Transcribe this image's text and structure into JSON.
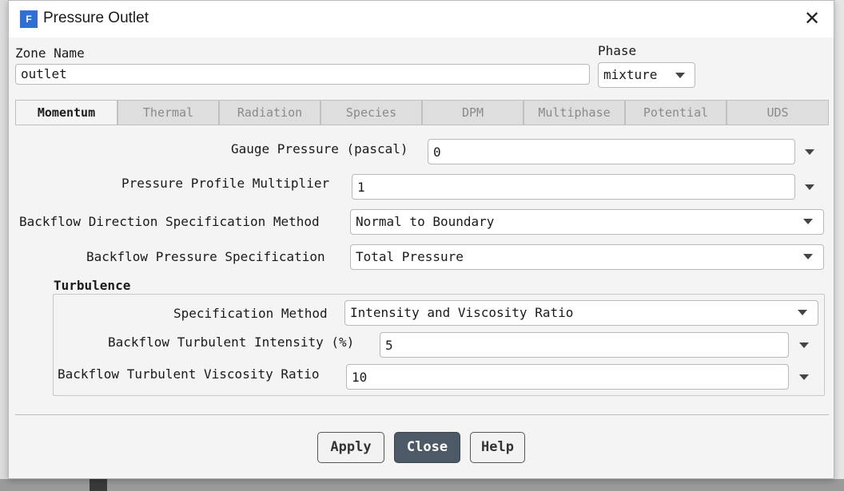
{
  "window": {
    "title": "Pressure Outlet",
    "icon": "fluent-app-icon",
    "close_glyph": "✕"
  },
  "zone": {
    "label": "Zone Name",
    "value": "outlet"
  },
  "phase": {
    "label": "Phase",
    "value": "mixture"
  },
  "tabs": [
    {
      "label": "Momentum",
      "active": true
    },
    {
      "label": "Thermal"
    },
    {
      "label": "Radiation"
    },
    {
      "label": "Species"
    },
    {
      "label": "DPM"
    },
    {
      "label": "Multiphase"
    },
    {
      "label": "Potential"
    },
    {
      "label": "UDS"
    }
  ],
  "momentum": {
    "gauge_pressure": {
      "label": "Gauge Pressure (pascal)",
      "value": "0"
    },
    "pressure_profile_multiplier": {
      "label": "Pressure Profile Multiplier",
      "value": "1"
    },
    "backflow_direction": {
      "label": "Backflow Direction Specification Method",
      "value": "Normal to Boundary"
    },
    "backflow_pressure": {
      "label": "Backflow Pressure Specification",
      "value": "Total Pressure"
    }
  },
  "turbulence": {
    "title": "Turbulence",
    "spec_method": {
      "label": "Specification Method",
      "value": "Intensity and Viscosity Ratio"
    },
    "intensity": {
      "label": "Backflow Turbulent Intensity (%)",
      "value": "5"
    },
    "viscosity_ratio": {
      "label": "Backflow Turbulent Viscosity Ratio",
      "value": "10"
    }
  },
  "buttons": {
    "apply": "Apply",
    "close": "Close",
    "help": "Help"
  }
}
